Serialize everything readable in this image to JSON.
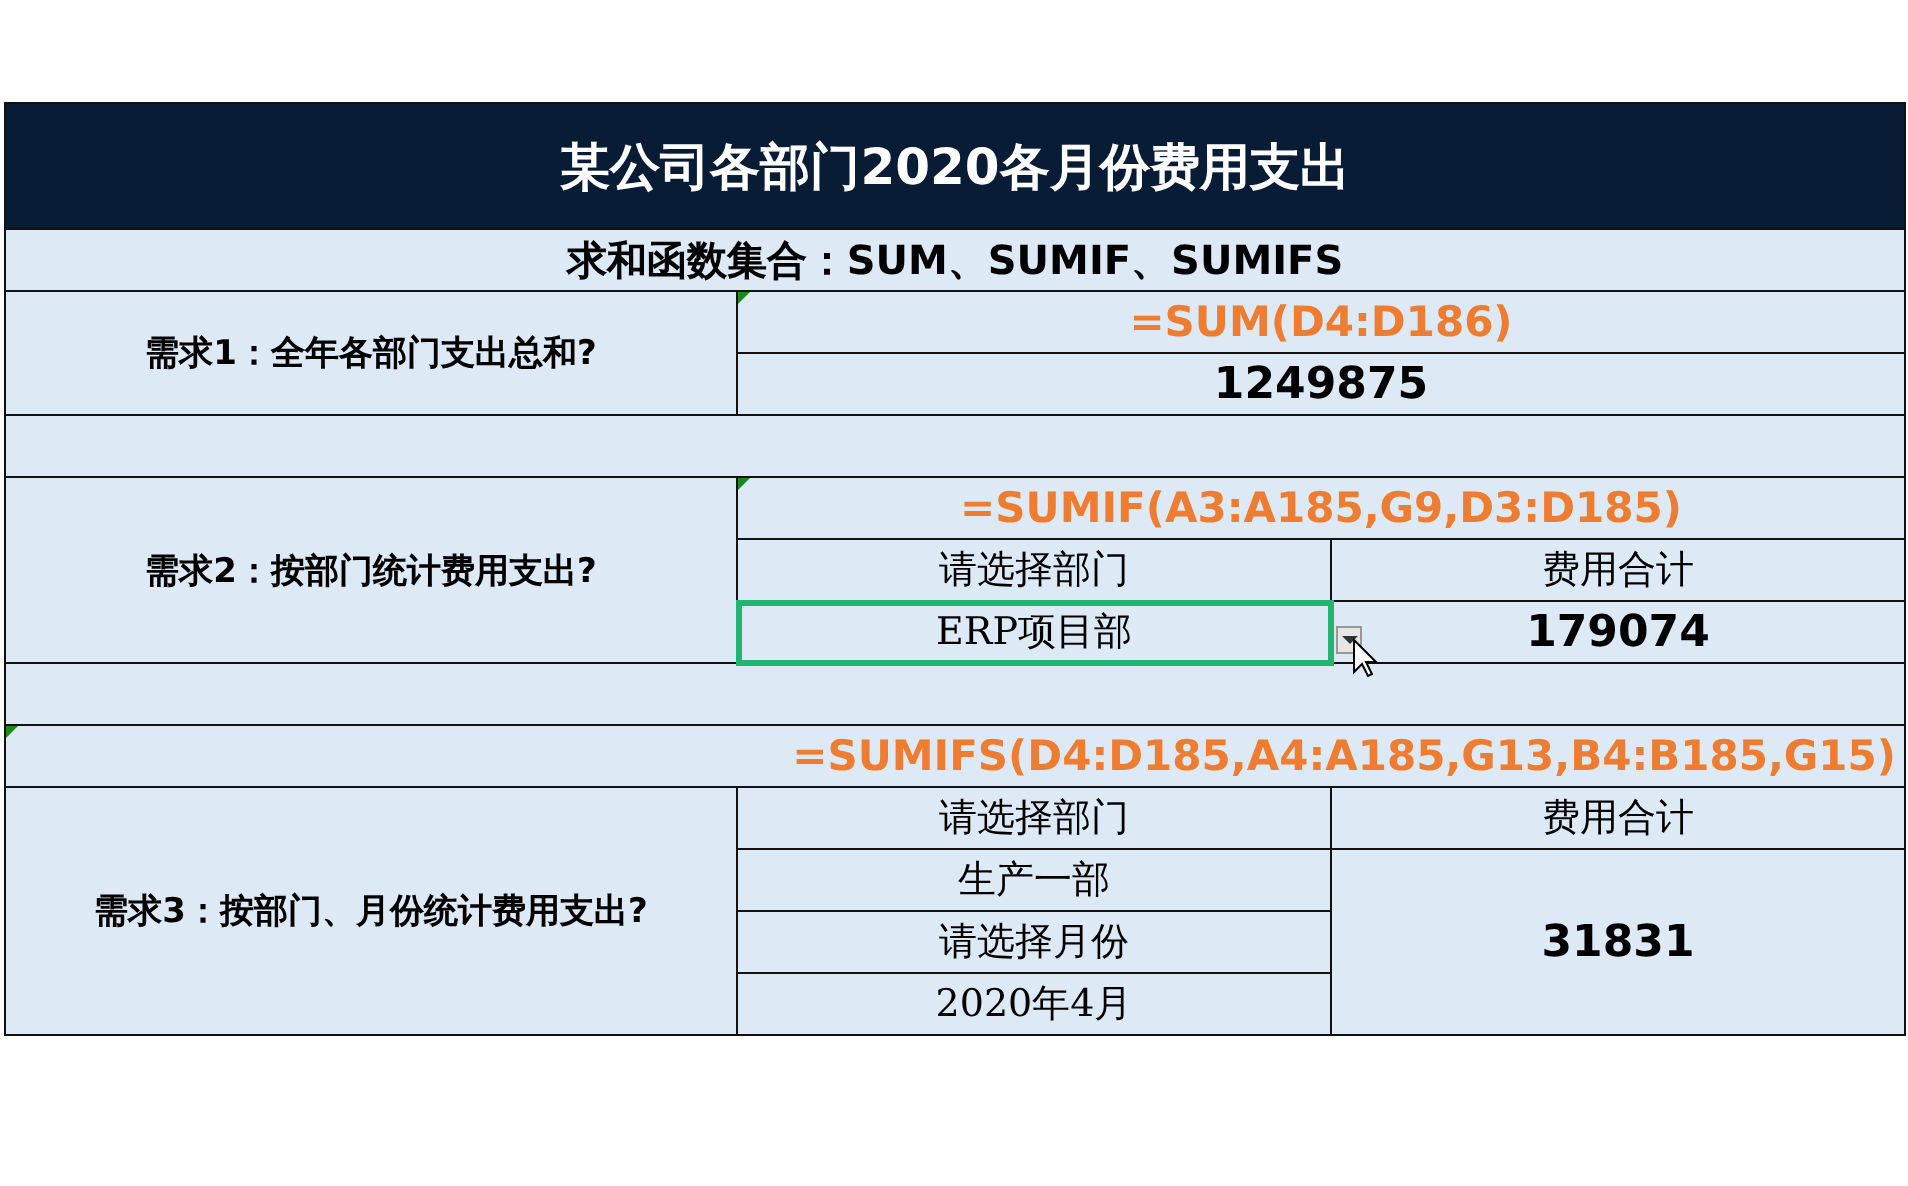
{
  "title": "某公司各部门2020各月份费用支出",
  "subtitle": "求和函数集合：SUM、SUMIF、SUMIFS",
  "sections": [
    {
      "kind": "sum",
      "label": "需求1：全年各部门支出总和?",
      "formula": "=SUM(D4:D186)",
      "value": "1249875"
    },
    {
      "kind": "sumif",
      "label": "需求2：按部门统计费用支出?",
      "formula": "=SUMIF(A3:A185,G9,D3:D185)",
      "dept_header": "请选择部门",
      "total_header": "费用合计",
      "dept": {
        "value": "ERP项目部",
        "selected": true
      },
      "total": "179074"
    },
    {
      "kind": "sumifs",
      "label": "需求3：按部门、月份统计费用支出?",
      "formula": "=SUMIFS(D4:D185,A4:A185,G13,B4:B185,G15)",
      "dept_header": "请选择部门",
      "total_header": "费用合计",
      "dept": "生产一部",
      "month_header": "请选择月份",
      "month": "2020年4月",
      "total": "31831"
    }
  ]
}
